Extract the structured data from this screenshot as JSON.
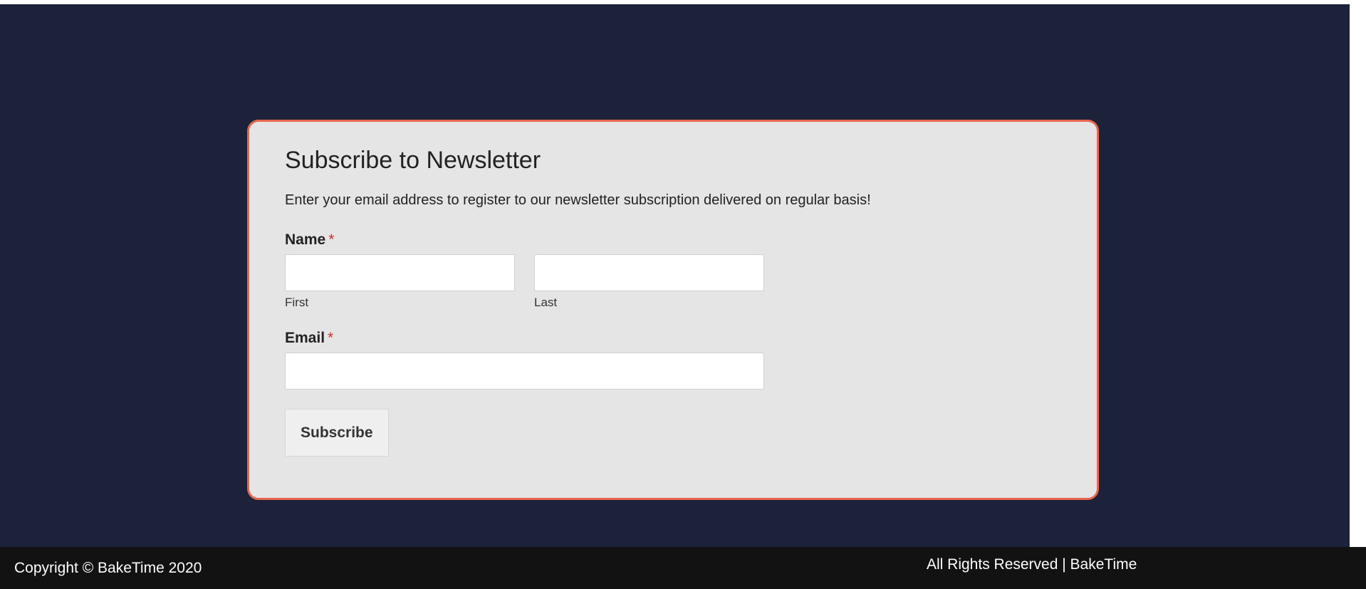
{
  "newsletter": {
    "title": "Subscribe to Newsletter",
    "description": "Enter your email address to register to our newsletter subscription delivered on regular basis!",
    "name_label": "Name",
    "required_mark": "*",
    "first_value": "",
    "first_sublabel": "First",
    "last_value": "",
    "last_sublabel": "Last",
    "email_label": "Email",
    "email_value": "",
    "submit_label": "Subscribe"
  },
  "footer": {
    "copyright": "Copyright © BakeTime 2020",
    "rights": "All Rights Reserved | BakeTime"
  },
  "colors": {
    "background": "#1b2239",
    "card": "#e5e5e5",
    "card_border": "#e8664b",
    "required": "#d0312d",
    "footer": "#121212"
  }
}
